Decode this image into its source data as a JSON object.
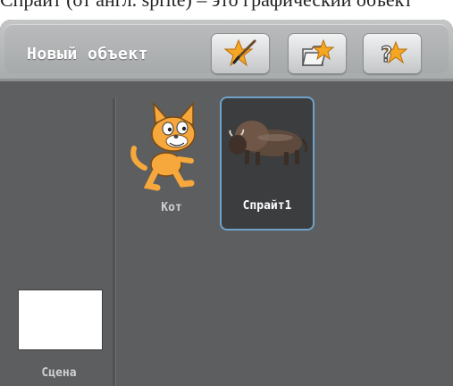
{
  "top_strip_text": "Спрайт (от англ. sprite) – это графический объект",
  "panel": {
    "title": "Новый объект",
    "buttons": {
      "paint": {
        "icon": "paint-new-sprite-icon"
      },
      "open": {
        "icon": "folder-star-icon"
      },
      "random": {
        "icon": "surprise-sprite-icon"
      }
    }
  },
  "stage": {
    "label": "Сцена"
  },
  "sprites": [
    {
      "name": "Кот",
      "icon": "cat-sprite-icon",
      "selected": false
    },
    {
      "name": "Спрайт1",
      "icon": "bison-sprite-icon",
      "selected": true
    }
  ],
  "colors": {
    "panel_bg": "#5d5e5f",
    "header_bg": "#b2b5b6",
    "selection_border": "#6fa2c8",
    "star": "#f5a623",
    "cat": "#f7a83c"
  }
}
